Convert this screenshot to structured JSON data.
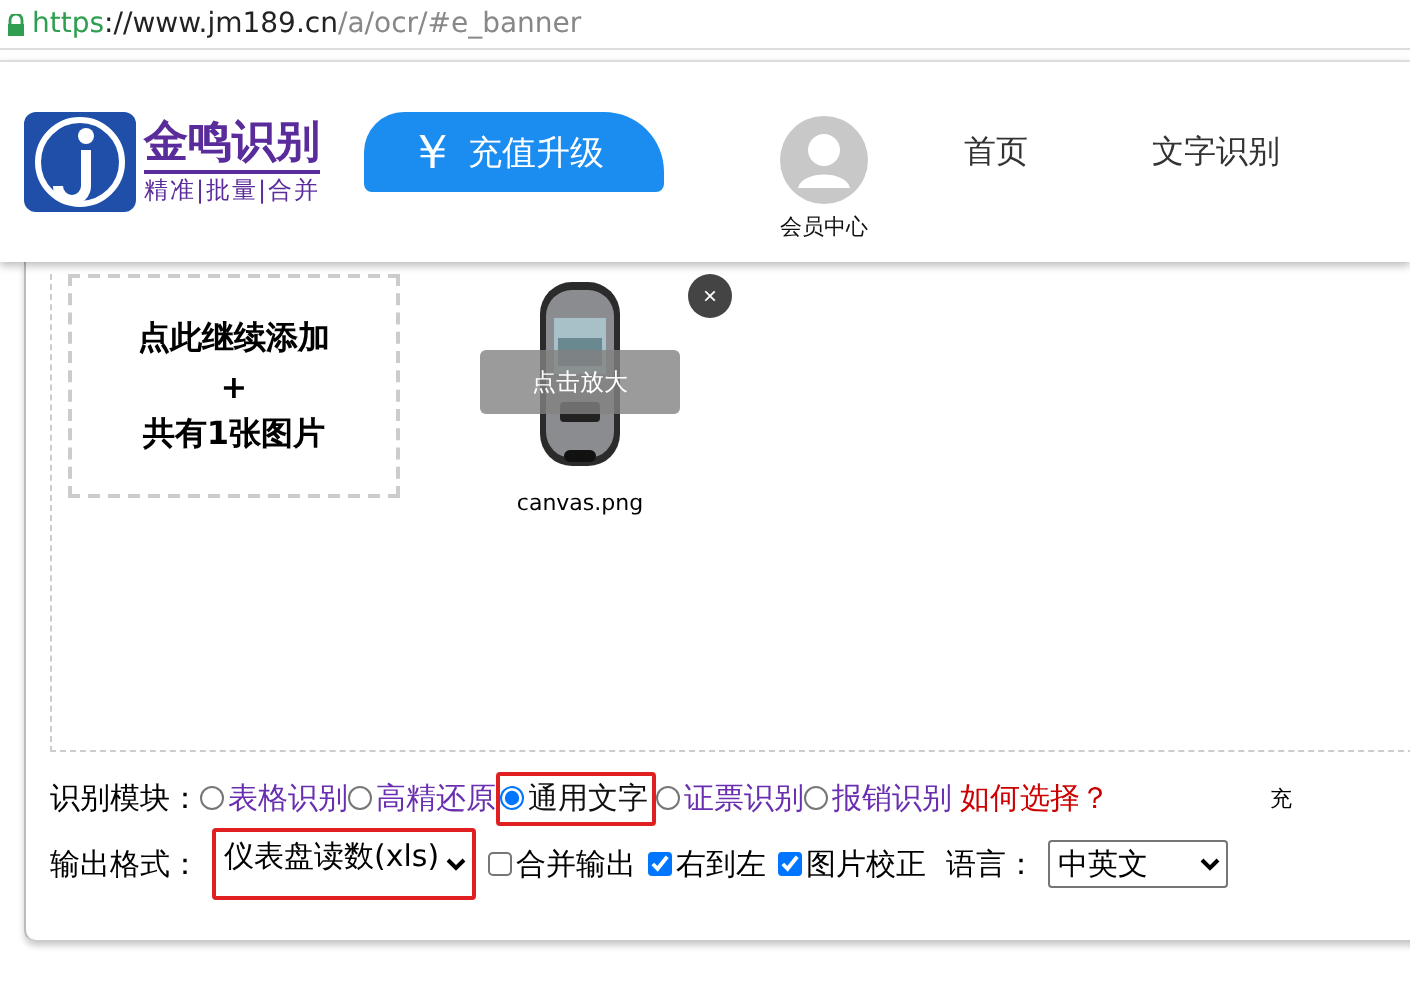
{
  "address_bar": {
    "scheme": "https",
    "host": "://www.jm189.cn",
    "path": "/a/ocr/#e_banner"
  },
  "header": {
    "logo_title": "金鸣识别",
    "logo_slogan": "精准|批量|合并",
    "recharge_button": "充值升级",
    "recharge_symbol": "￥",
    "member": "会员中心",
    "nav": [
      "首页",
      "文字识别"
    ]
  },
  "upload": {
    "add_tile": [
      "点此继续添加",
      "+",
      "共有1张图片"
    ],
    "files": [
      {
        "name": "canvas.png",
        "overlay": "点击放大",
        "close": "×",
        "kind": "picture"
      }
    ]
  },
  "module_row": {
    "label": "识别模块：",
    "options": [
      {
        "label": "表格识别",
        "selected": false,
        "highlighted": false
      },
      {
        "label": "高精还原",
        "selected": false,
        "highlighted": false
      },
      {
        "label": "通用文字",
        "selected": true,
        "highlighted": true
      },
      {
        "label": "证票识别",
        "selected": false,
        "highlighted": false
      },
      {
        "label": "报销识别",
        "selected": false,
        "highlighted": false
      }
    ],
    "help_link": "如何选择？",
    "cut_text": "充"
  },
  "format_row": {
    "label": "输出格式：",
    "format": {
      "value": "仪表盘读数(xls)",
      "highlighted": true
    },
    "checkboxes": [
      {
        "label": "合并输出",
        "checked": false
      },
      {
        "label": "右到左",
        "checked": true
      },
      {
        "label": "图片校正",
        "checked": true
      }
    ],
    "language_label": "语言：",
    "language": {
      "value": "中英文",
      "highlighted": false
    }
  }
}
